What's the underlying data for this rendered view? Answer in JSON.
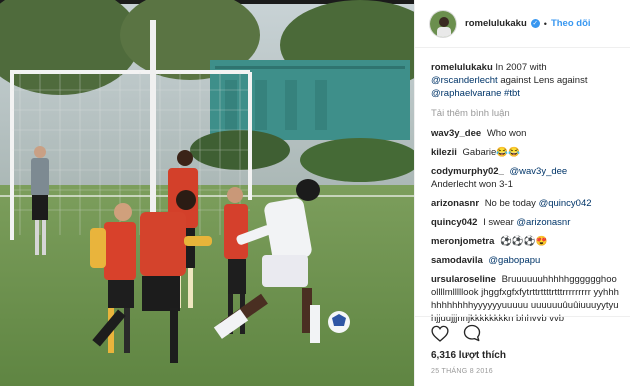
{
  "post": {
    "header": {
      "username": "romelulukaku",
      "follow_label": "Theo dõi",
      "separator": "•"
    },
    "caption": {
      "username": "romelulukaku",
      "text_1": "In 2007 with",
      "mention_1": "@rscanderlecht",
      "text_2": "against Lens against",
      "mention_2": "@raphaelvarane",
      "hashtag": "#tbt"
    },
    "load_more_label": "Tải thêm bình luận",
    "comments": [
      {
        "username": "wav3y_dee",
        "text": "Who won"
      },
      {
        "username": "kilezii",
        "text": "Gabarie😂😂"
      },
      {
        "username": "codymurphy02_",
        "mention": "@wav3y_dee",
        "text": "Anderlecht won 3-1"
      },
      {
        "username": "arizonasnr",
        "text": "No be today",
        "mention": "@quincy042"
      },
      {
        "username": "quincy042",
        "text": "I swear",
        "mention": "@arizonasnr"
      },
      {
        "username": "meronjometra",
        "text": "⚽⚽⚽😍"
      },
      {
        "username": "samodavila",
        "mention": "@gabopapu"
      },
      {
        "username": "ursularoseline",
        "text": "Bruuuuuuhhhhhgggggghooollllmlllllook jhggfxgfxfytrttrttttrtttrrrrrrrrr yyhhhhhhhhhhhyyyyyyuuuuu uuuuuuûuûiuuuyytyuhjjuujjjnnjkkkkkkkkn bhhvvb vvb"
      }
    ],
    "likes_label": "6,316 lượt thích",
    "date_label": "25 THÁNG 8 2016"
  },
  "colors": {
    "link": "#003569",
    "follow": "#3897f0",
    "muted": "#999999"
  },
  "icons": [
    "verified-badge-icon",
    "heart-icon",
    "comment-icon"
  ]
}
